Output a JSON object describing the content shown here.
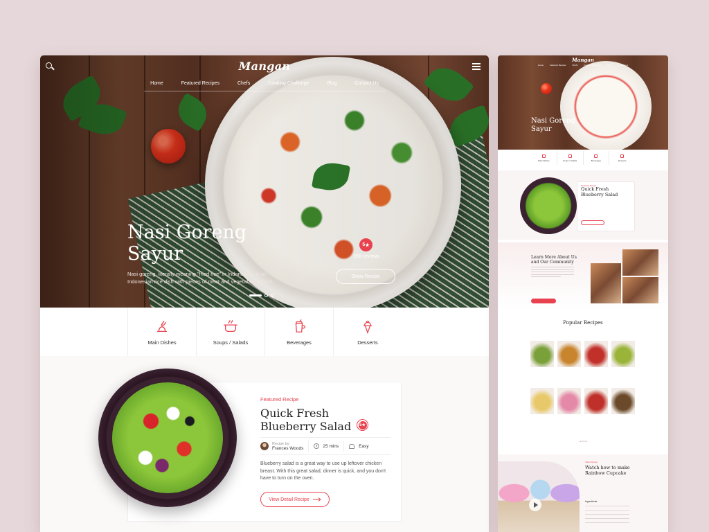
{
  "brand": {
    "logo": "Mangan",
    "accent": "#e8424f"
  },
  "nav": {
    "items": [
      "Home",
      "Featured Recipes",
      "Chefs",
      "Cooking Challenge",
      "Blog",
      "Contact Us"
    ]
  },
  "hero": {
    "title_line1": "Nasi Goreng",
    "title_line2": "Sayur",
    "description": "Nasi goreng, literally meaning \"fried rice\" in Indonesian, is an Indonesian rice dish with pieces of meat and vegetables added.",
    "rating": "5",
    "reviews": "268 reviews",
    "cta": "Show Recipe",
    "slide_count": 3,
    "active_slide": 1
  },
  "categories": [
    {
      "label": "Main Dishes",
      "icon": "main-dishes-icon"
    },
    {
      "label": "Soups / Salads",
      "icon": "pot-icon"
    },
    {
      "label": "Beverages",
      "icon": "cup-icon"
    },
    {
      "label": "Desserts",
      "icon": "ice-cream-icon"
    }
  ],
  "featured": {
    "kicker": "Featured Recipe",
    "title_line1": "Quick Fresh",
    "title_line2": "Blueberry Salad",
    "rating": "5",
    "recipe_by_label": "Recipe by:",
    "author": "Frances Woods",
    "time": "25 mins",
    "difficulty": "Easy",
    "description": "Blueberry salad is a great way to use up leftover chicken breast. With this great salad, dinner is quick, and you don't have to turn on the oven.",
    "cta": "View Detail Recipe"
  },
  "preview": {
    "logo": "Mangan",
    "nav": [
      "Home",
      "Featured Recipes",
      "Chefs",
      "Cooking Challenge",
      "Blog",
      "Contact Us"
    ],
    "hero_line1": "Nasi Goreng",
    "hero_line2": "Sayur",
    "categories": [
      "Main Dishes",
      "Soups / Salads",
      "Beverages",
      "Desserts"
    ],
    "featured_kicker": "Featured Recipe",
    "featured_line1": "Quick Fresh",
    "featured_line2": "Blueberry Salad",
    "about_line1": "Learn More About Us",
    "about_line2": "and Our Community",
    "popular_title": "Popular Recipes",
    "cupcake_kicker": "Video Recipe",
    "cupcake_line1": "Watch how to make",
    "cupcake_line2": "Rainbow Cupcake",
    "ingredients_label": "Ingredients",
    "recipe_tiles": [
      "#7aa03a",
      "#c8852e",
      "#c2302a",
      "#9ab43a",
      "#e8c96a",
      "#e48aa8",
      "#c0302a",
      "#6a4a2a"
    ]
  }
}
